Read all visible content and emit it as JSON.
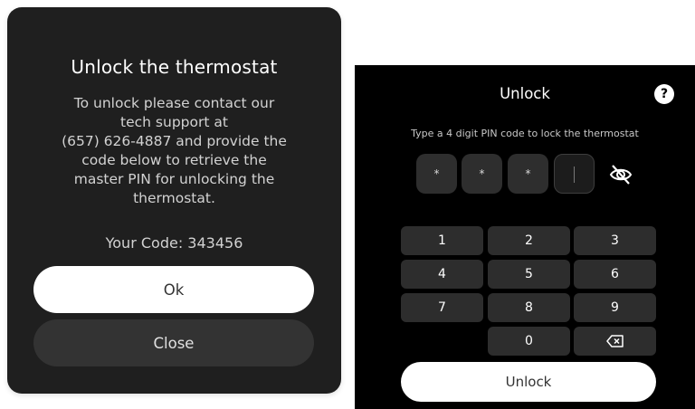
{
  "dialog": {
    "title": "Unlock the thermostat",
    "message_lines": [
      "To unlock please contact our",
      "tech support at",
      "(657) 626-4887 and provide the",
      "code below to retrieve the",
      "master PIN for unlocking the",
      "thermostat."
    ],
    "code_text": "Your Code: 343456",
    "ok_label": "Ok",
    "close_label": "Close"
  },
  "keypad": {
    "title": "Unlock",
    "help_icon": "?",
    "instruction": "Type a 4 digit PIN code to lock the thermostat",
    "pin": [
      "*",
      "*",
      "*",
      ""
    ],
    "visibility_icon": "eye-off-icon",
    "keys": [
      "1",
      "2",
      "3",
      "4",
      "5",
      "6",
      "7",
      "8",
      "9",
      "0"
    ],
    "backspace_icon": "backspace-icon",
    "unlock_label": "Unlock"
  }
}
